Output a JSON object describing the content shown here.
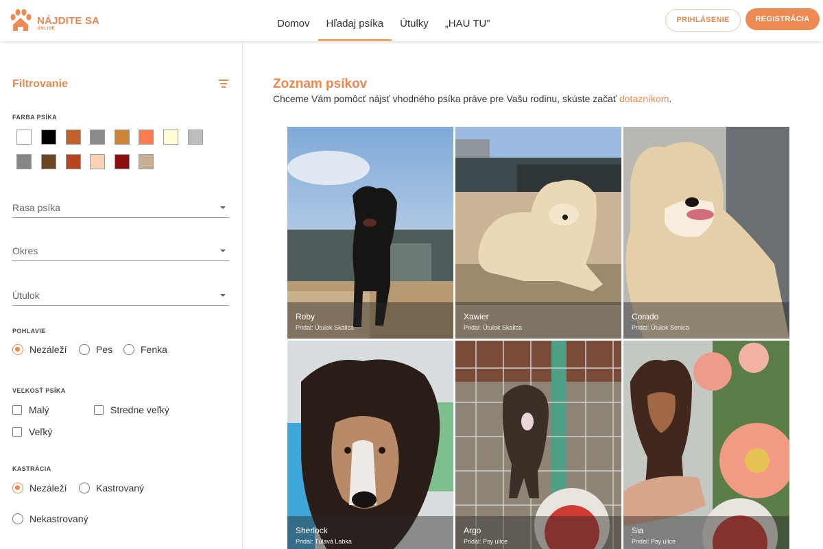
{
  "brand": {
    "name": "NÁJDITE SA",
    "sub": "ONLINE",
    "color": "#e9884f"
  },
  "nav": [
    {
      "label": "Domov"
    },
    {
      "label": "Hľadaj psíka",
      "active": true
    },
    {
      "label": "Útulky"
    },
    {
      "label": "„HAU TU”"
    }
  ],
  "auth": {
    "login": "PRIHLÁSENIE",
    "register": "REGISTRÁCIA"
  },
  "filters": {
    "title": "Filtrovanie",
    "color_label": "FARBA PSÍKA",
    "colors": [
      "#ffffff",
      "#000000",
      "#c0602e",
      "#8a8a8a",
      "#cc8436",
      "#fb7b52",
      "#fefdd4",
      "#bdbdbd",
      "#878787",
      "#6b4421",
      "#b8451f",
      "#fdd2b5",
      "#8b0f10",
      "#c8b095"
    ],
    "breed": "Rasa psíka",
    "district": "Okres",
    "shelter": "Útulok",
    "gender": {
      "label": "POHLAVIE",
      "options": [
        "Nezáleží",
        "Pes",
        "Fenka"
      ],
      "selected": 0
    },
    "size": {
      "label": "VEĽKOSŤ PSÍKA",
      "options": [
        "Malý",
        "Stredne veľký",
        "Veľký"
      ]
    },
    "castration": {
      "label": "KASTRÁCIA",
      "options": [
        "Nezáleží",
        "Kastrovaný",
        "Nekastrovaný"
      ],
      "selected": 0
    }
  },
  "main": {
    "title": "Zoznam psíkov",
    "subtitle": "Chceme Vám pomôcť nájsť vhodného psíka práve pre Vašu rodinu, skúste začať ",
    "subtitle_link": "dotazníkom",
    "subtitle_end": "."
  },
  "dogs": [
    {
      "name": "Roby",
      "added": "Pridal: Útulok Skalica"
    },
    {
      "name": "Xawier",
      "added": "Pridal: Útulok Skalica"
    },
    {
      "name": "Corado",
      "added": "Pridal: Útulok Senica"
    },
    {
      "name": "Sherlock",
      "added": "Pridal: Túlavá Labka"
    },
    {
      "name": "Argo",
      "added": "Pridal: Psy ulice"
    },
    {
      "name": "Sia",
      "added": "Pridal: Psy ulice"
    }
  ]
}
